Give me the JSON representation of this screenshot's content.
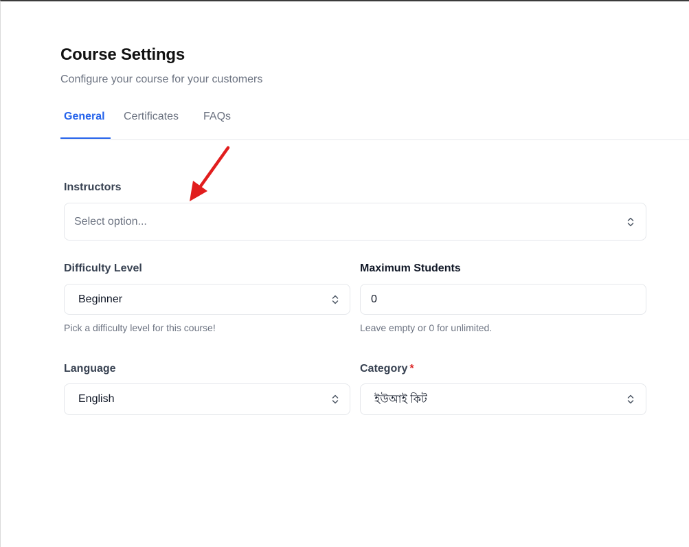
{
  "header": {
    "title": "Course Settings",
    "subtitle": "Configure your course for your customers"
  },
  "tabs": [
    {
      "label": "General",
      "active": true
    },
    {
      "label": "Certificates",
      "active": false
    },
    {
      "label": "FAQs",
      "active": false
    }
  ],
  "form": {
    "instructors": {
      "label": "Instructors",
      "placeholder": "Select option..."
    },
    "difficulty": {
      "label": "Difficulty Level",
      "value": "Beginner",
      "help": "Pick a difficulty level for this course!"
    },
    "max_students": {
      "label": "Maximum Students",
      "value": "0",
      "help": "Leave empty or 0 for unlimited."
    },
    "language": {
      "label": "Language",
      "value": "English"
    },
    "category": {
      "label": "Category",
      "required_mark": "*",
      "value": "ইউআই কিট"
    }
  },
  "icons": {
    "select_chevron": "chevron-up-down-icon",
    "annotation": "red-arrow-icon"
  },
  "colors": {
    "accent": "#2563eb",
    "required": "#dc2626",
    "annotation_arrow": "#e11d1d",
    "muted_text": "#6b7280",
    "border": "#e5e7eb"
  }
}
